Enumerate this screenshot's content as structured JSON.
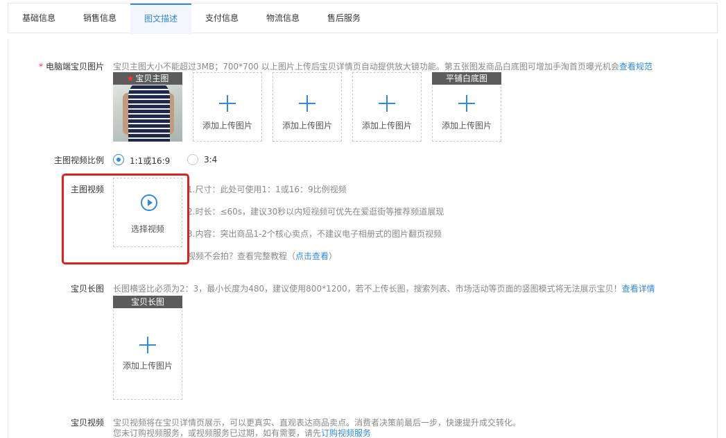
{
  "tabs": [
    {
      "label": "基础信息",
      "active": false
    },
    {
      "label": "销售信息",
      "active": false
    },
    {
      "label": "图文描述",
      "active": true
    },
    {
      "label": "支付信息",
      "active": false
    },
    {
      "label": "物流信息",
      "active": false
    },
    {
      "label": "售后服务",
      "active": false
    }
  ],
  "main_images": {
    "label": "电脑端宝贝图片",
    "required_mark": "*",
    "hint": "宝贝主图大小不能超过3MB；700*700 以上图片上传后宝贝详情页自动提供放大镜功能。第五张图发商品白底图可增加手淘首页曝光机会",
    "hint_link": "查看规范",
    "main_tag": "宝贝主图",
    "main_tag_star": "★",
    "upload_text": "添加上传图片",
    "white_bg_tag": "平铺白底图"
  },
  "video_ratio": {
    "label": "主图视频比例",
    "options": [
      {
        "label": "1:1或16:9",
        "checked": true
      },
      {
        "label": "3:4",
        "checked": false
      }
    ]
  },
  "main_video": {
    "label": "主图视频",
    "button_text": "选择视频",
    "tips": [
      "1.尺寸：此处可使用1：1或16：9比例视频",
      "2.时长：≤60s，建议30秒以内短视频可优先在爱逛街等推荐频道展现",
      "3.内容：突出商品1-2个核心卖点，不建议电子相册式的图片翻页视频"
    ],
    "tutorial_prefix": "视频不会拍？查看完整教程（",
    "tutorial_link": "点击查看",
    "tutorial_suffix": "）"
  },
  "long_image": {
    "label": "宝贝长图",
    "hint": "长图横竖比必须为2：3，最小长度为480，建议使用800*1200，若不上传长图，搜索列表、市场活动等页面的竖图模式将无法展示宝贝！",
    "hint_link": "查看详情",
    "tag": "宝贝长图",
    "upload_text": "添加上传图片"
  },
  "product_video": {
    "label": "宝贝视频",
    "line1": "宝贝视频将在宝贝详情页展示，可以更真实、直观表达商品卖点。消费者决策前最后一步，快速提升成交转化。",
    "line2_prefix": "您未订购视频服务，或视频服务已过期，如有需要，请先",
    "line2_link": "订购视频服务"
  },
  "colors": {
    "accent": "#3089dc",
    "required": "#ff3333",
    "highlight": "#e0201a",
    "tag_bg": "#5c5c5c"
  }
}
